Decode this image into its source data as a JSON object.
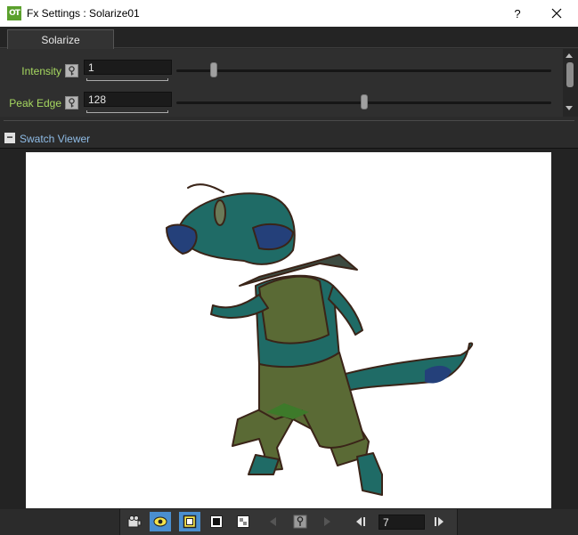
{
  "window": {
    "app_icon_text": "OT",
    "title": "Fx Settings : Solarize01",
    "help_label": "?"
  },
  "tabs": [
    {
      "label": "Solarize"
    }
  ],
  "params": [
    {
      "label": "Intensity",
      "value": "1",
      "slider_fraction": 0.1
    },
    {
      "label": "Peak Edge",
      "value": "128",
      "slider_fraction": 0.5
    }
  ],
  "swatch": {
    "label": "Swatch Viewer",
    "collapse_symbol": "−"
  },
  "toolbar": {
    "buttons": [
      {
        "icon": "camera-icon",
        "active": false
      },
      {
        "icon": "eye-icon",
        "active": true
      },
      {
        "icon": "white-bg-icon",
        "active": true
      },
      {
        "icon": "black-bg-icon",
        "active": false
      },
      {
        "icon": "checker-bg-icon",
        "active": false
      },
      {
        "icon": "prev-key-icon",
        "active": false
      },
      {
        "icon": "key-icon",
        "active": false
      },
      {
        "icon": "next-key-icon",
        "active": false
      },
      {
        "icon": "prev-frame-icon",
        "active": false
      },
      {
        "icon": "next-frame-icon",
        "active": false
      }
    ],
    "frame_value": "7"
  },
  "colors": {
    "label_green": "#a6d860",
    "link_blue": "#8fbce6",
    "active_button": "#4a8fd0",
    "character_teal": "#1f6b66",
    "character_olive": "#5a6a35"
  }
}
